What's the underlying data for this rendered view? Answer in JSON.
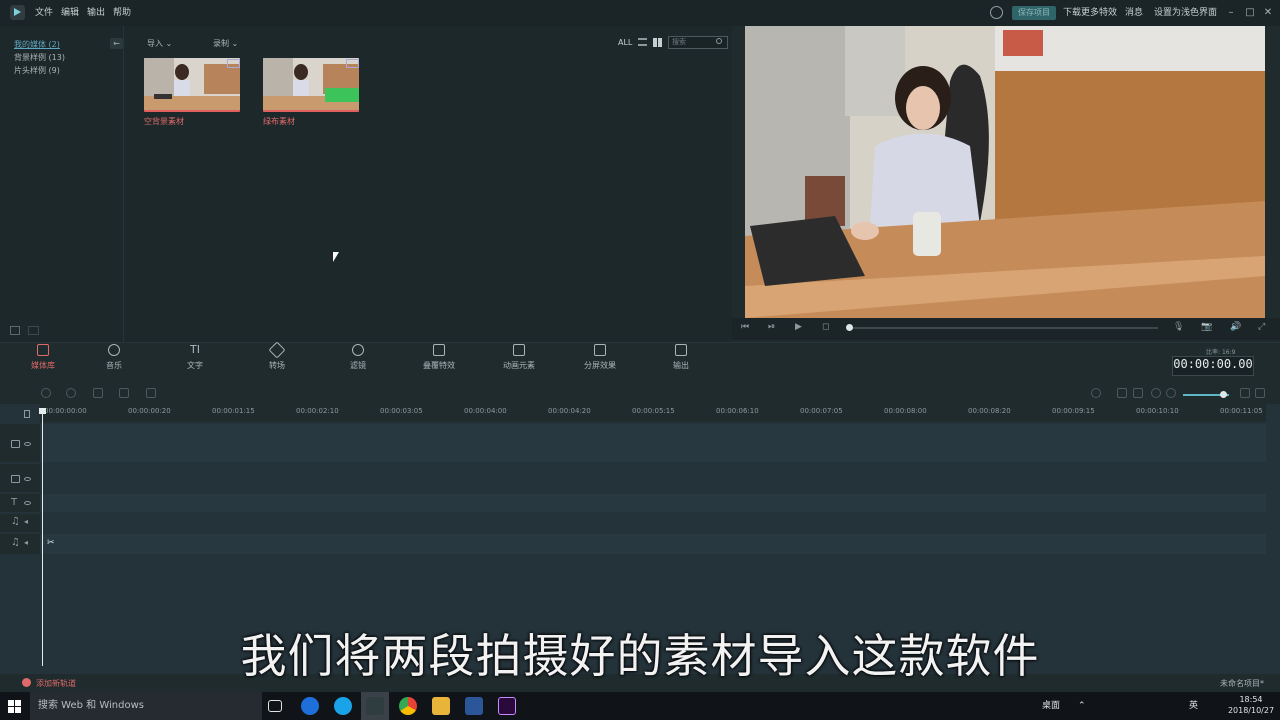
{
  "app": {
    "menu": [
      "文件",
      "编辑",
      "输出",
      "帮助"
    ],
    "save_project": "保存项目",
    "download_effects": "下载更多特效",
    "messages": "消息",
    "light_mode": "设置为浅色界面"
  },
  "library": {
    "categories": [
      "我的媒体 (2)",
      "背景样例 (13)",
      "片头样例 (9)"
    ],
    "import_label": "导入",
    "record_label": "录制",
    "filter_all": "ALL",
    "search_placeholder": "搜索",
    "clips": [
      {
        "name": "空背景素材"
      },
      {
        "name": "绿布素材"
      }
    ]
  },
  "tabs": [
    {
      "label": "媒体库",
      "active": true
    },
    {
      "label": "音乐"
    },
    {
      "label": "文字"
    },
    {
      "label": "转场"
    },
    {
      "label": "滤镜"
    },
    {
      "label": "叠覆特效"
    },
    {
      "label": "动画元素"
    },
    {
      "label": "分屏效果"
    },
    {
      "label": "输出"
    }
  ],
  "preview": {
    "ratio": "16:9",
    "timecode": "00:00:00.00"
  },
  "timeline": {
    "ticks": [
      "00:00:00:00",
      "00:00:00:20",
      "00:00:01:15",
      "00:00:02:10",
      "00:00:03:05",
      "00:00:04:00",
      "00:00:04:20",
      "00:00:05:15",
      "00:00:06:10",
      "00:00:07:05",
      "00:00:08:00",
      "00:00:08:20",
      "00:00:09:15",
      "00:00:10:10",
      "00:00:11:05"
    ],
    "add_track": "添加新轨道",
    "project_name": "未命名项目*"
  },
  "subtitle": "我们将两段拍摄好的素材导入这款软件",
  "taskbar": {
    "search": "搜索 Web 和 Windows",
    "desktop": "桌面",
    "lang": "英",
    "time": "18:54",
    "date": "2018/10/27"
  },
  "colors": {
    "accent": "#e06a6a",
    "link": "#5fa7c0",
    "panel": "#1d282a"
  }
}
